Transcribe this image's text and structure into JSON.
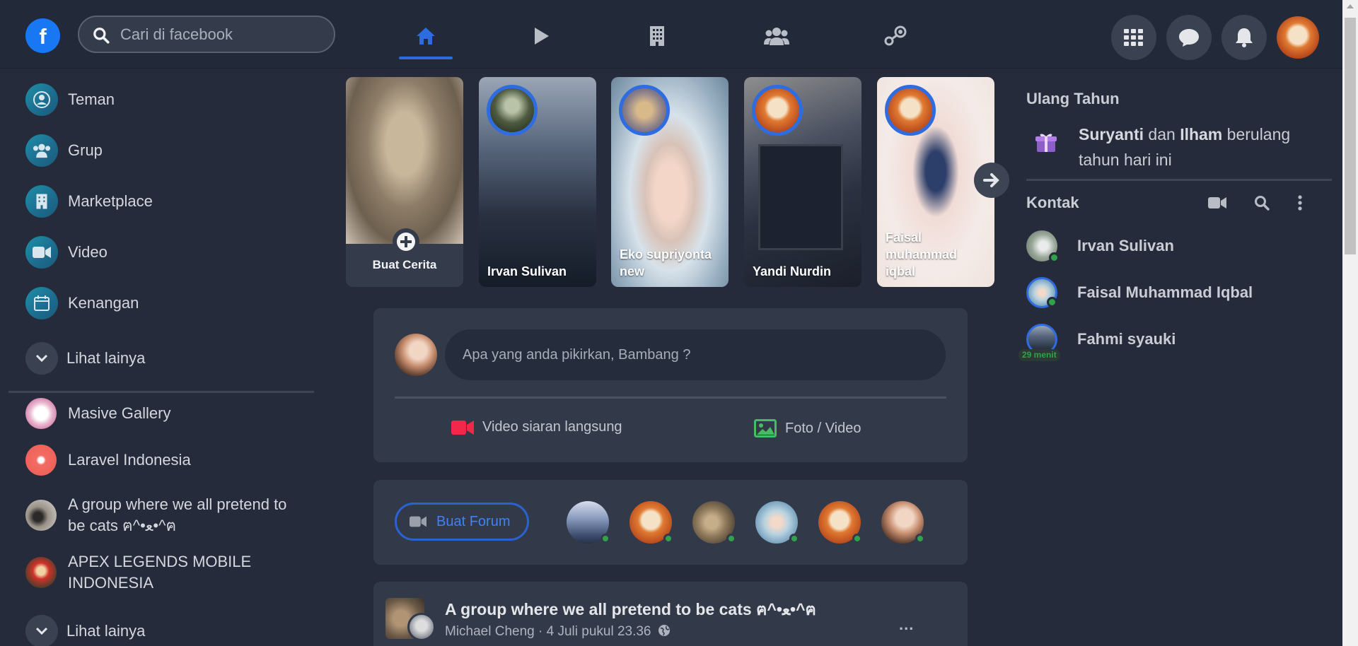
{
  "header": {
    "logo": "f",
    "search_placeholder": "Cari di facebook",
    "nav_icons": [
      "home-icon",
      "play-icon",
      "building-icon",
      "group-icon",
      "gamepad-icon"
    ],
    "right_icons": [
      "grid-icon",
      "messenger-icon",
      "bell-icon",
      "profile-avatar"
    ]
  },
  "sidebar": {
    "items": [
      {
        "label": "Teman",
        "icon": "friends-icon"
      },
      {
        "label": "Grup",
        "icon": "group-icon"
      },
      {
        "label": "Marketplace",
        "icon": "marketplace-icon"
      },
      {
        "label": "Video",
        "icon": "video-icon"
      },
      {
        "label": "Kenangan",
        "icon": "calendar-icon"
      }
    ],
    "see_more_1": "Lihat lainya",
    "groups": [
      {
        "label": "Masive Gallery"
      },
      {
        "label": "Laravel Indonesia"
      },
      {
        "label": "A group where we all pretend to be cats ฅ^•ﻌ•^ฅ"
      },
      {
        "label": "APEX LEGENDS MOBILE INDONESIA"
      }
    ],
    "see_more_2": "Lihat lainya"
  },
  "stories": [
    {
      "name": "Buat Cerita",
      "type": "create"
    },
    {
      "name": "Irvan Sulivan"
    },
    {
      "name": "Eko supriyonta new"
    },
    {
      "name": "Yandi Nurdin"
    },
    {
      "name": "Faisal muhammad iqbal"
    }
  ],
  "composer": {
    "placeholder": "Apa yang anda pikirkan, Bambang ?",
    "live_label": "Video siaran langsung",
    "photo_label": "Foto / Video",
    "live_color": "#f02849",
    "photo_color": "#45bd62"
  },
  "forum": {
    "button_label": "Buat Forum"
  },
  "post": {
    "group_title": "A group where we all pretend to be cats ฅ^•ﻌ•^ฅ",
    "meta": "Michael Cheng · 4 Juli pukul 23.36",
    "more": "..."
  },
  "right": {
    "birthday_title": "Ulang Tahun",
    "birthday_name_1": "Suryanti",
    "birthday_mid": "dan",
    "birthday_name_2": "Ilham",
    "birthday_rest": "berulang tahun hari ini",
    "contacts_title": "Kontak",
    "contacts": [
      {
        "name": "Irvan Sulivan",
        "online": true
      },
      {
        "name": "Faisal Muhammad Iqbal",
        "online": true
      },
      {
        "name": "Fahmi syauki",
        "online": false,
        "badge": "29 menit"
      }
    ]
  },
  "colors": {
    "accent": "#2d6cdf",
    "online": "#31a24c",
    "background": "#252b3a"
  }
}
